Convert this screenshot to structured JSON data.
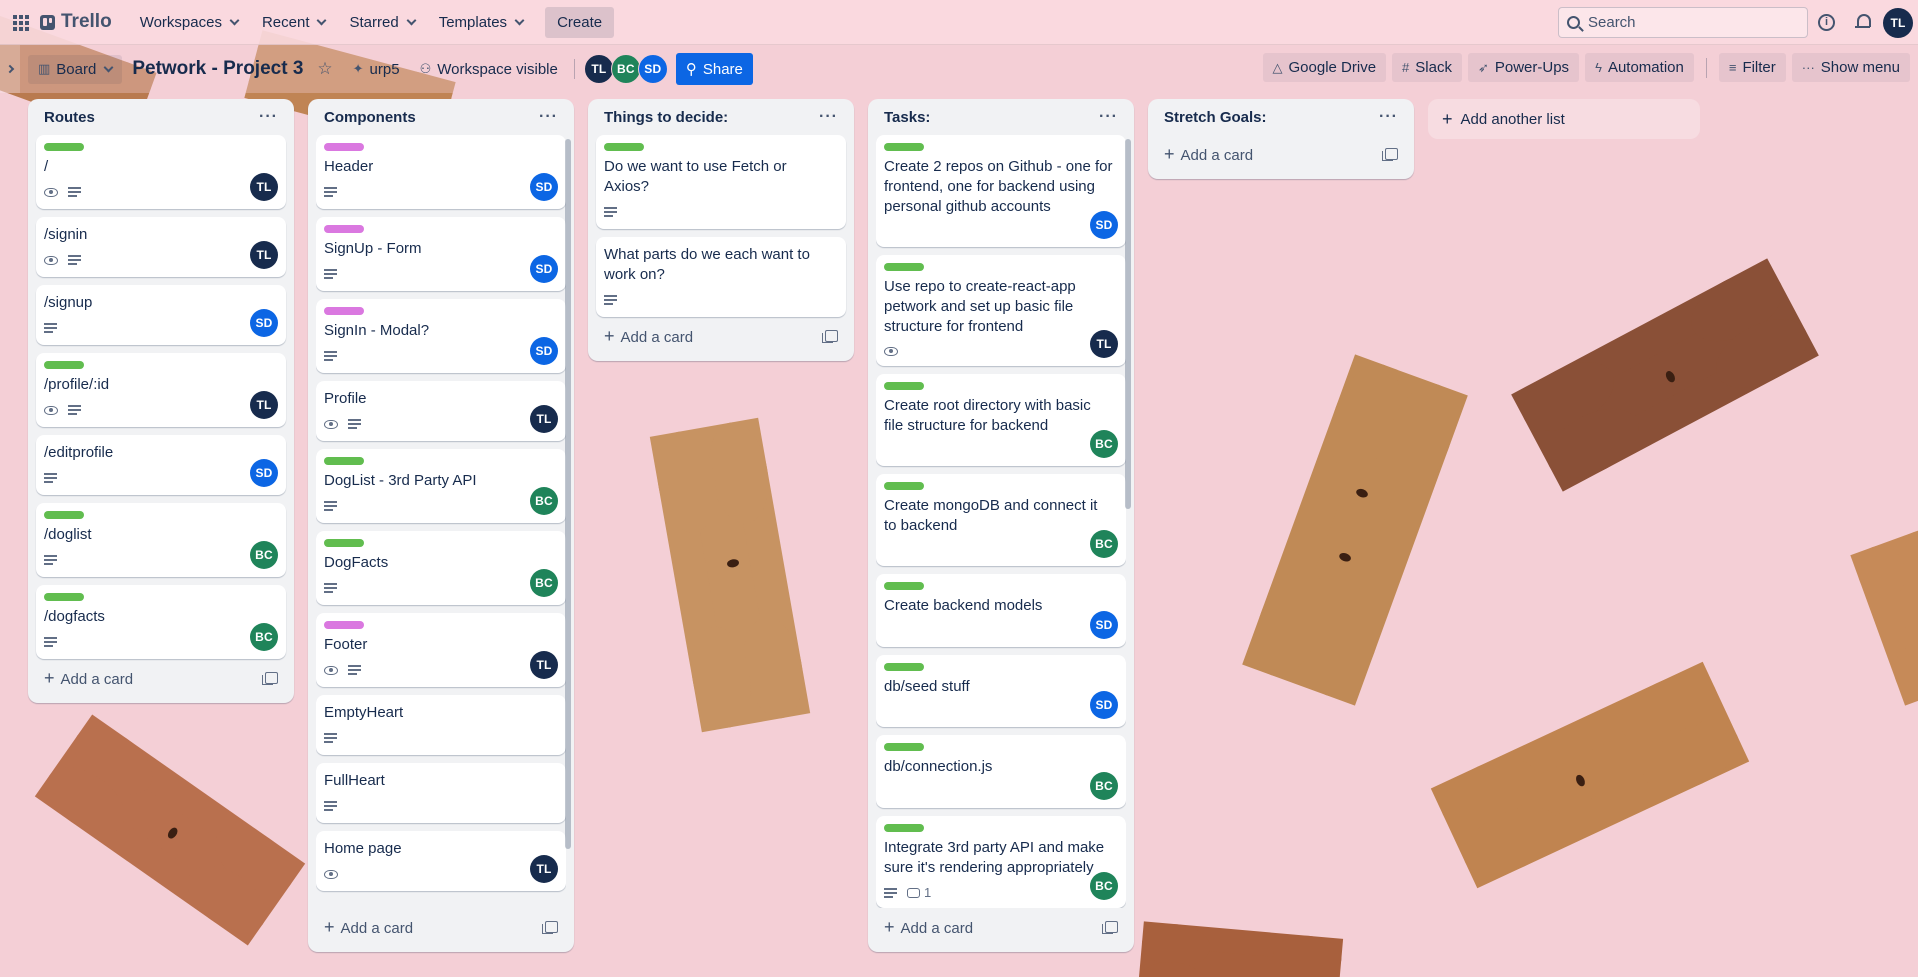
{
  "topnav": {
    "logo": "Trello",
    "menus": [
      "Workspaces",
      "Recent",
      "Starred",
      "Templates"
    ],
    "create_label": "Create",
    "search_placeholder": "Search",
    "user_initials": "TL"
  },
  "board": {
    "view_label": "Board",
    "title": "Petwork - Project 3",
    "workspace_label": "urp5",
    "visibility_label": "Workspace visible",
    "members": [
      "TL",
      "BC",
      "SD"
    ],
    "share_label": "Share",
    "right_buttons": [
      "Google Drive",
      "Slack",
      "Power-Ups",
      "Automation"
    ],
    "filter_label": "Filter",
    "show_menu_label": "Show menu"
  },
  "lists": [
    {
      "title": "Routes",
      "add_label": "Add a card",
      "cards": [
        {
          "title": "/",
          "label": "green",
          "watch": true,
          "desc": true,
          "member": "TL"
        },
        {
          "title": "/signin",
          "label": "",
          "watch": true,
          "desc": true,
          "member": "TL"
        },
        {
          "title": "/signup",
          "label": "",
          "watch": false,
          "desc": true,
          "member": "SD"
        },
        {
          "title": "/profile/:id",
          "label": "green",
          "watch": true,
          "desc": true,
          "member": "TL"
        },
        {
          "title": "/editprofile",
          "label": "",
          "watch": false,
          "desc": true,
          "member": "SD"
        },
        {
          "title": "/doglist",
          "label": "green",
          "watch": false,
          "desc": true,
          "member": "BC"
        },
        {
          "title": "/dogfacts",
          "label": "green",
          "watch": false,
          "desc": true,
          "member": "BC"
        }
      ]
    },
    {
      "title": "Components",
      "add_label": "Add a card",
      "cards": [
        {
          "title": "Header",
          "label": "purple",
          "watch": false,
          "desc": true,
          "member": "SD"
        },
        {
          "title": "SignUp - Form",
          "label": "purple",
          "watch": false,
          "desc": true,
          "member": "SD"
        },
        {
          "title": "SignIn - Modal?",
          "label": "purple",
          "watch": false,
          "desc": true,
          "member": "SD"
        },
        {
          "title": "Profile",
          "label": "",
          "watch": true,
          "desc": true,
          "member": "TL"
        },
        {
          "title": "DogList - 3rd Party API",
          "label": "green",
          "watch": false,
          "desc": true,
          "member": "BC"
        },
        {
          "title": "DogFacts",
          "label": "green",
          "watch": false,
          "desc": true,
          "member": "BC"
        },
        {
          "title": "Footer",
          "label": "purple",
          "watch": true,
          "desc": true,
          "member": "TL"
        },
        {
          "title": "EmptyHeart",
          "label": "",
          "watch": false,
          "desc": true,
          "member": ""
        },
        {
          "title": "FullHeart",
          "label": "",
          "watch": false,
          "desc": true,
          "member": ""
        },
        {
          "title": "Home page",
          "label": "",
          "watch": true,
          "desc": false,
          "member": "TL"
        }
      ]
    },
    {
      "title": "Things to decide:",
      "add_label": "Add a card",
      "cards": [
        {
          "title": "Do we want to use Fetch or Axios?",
          "label": "green",
          "watch": false,
          "desc": true,
          "member": ""
        },
        {
          "title": "What parts do we each want to work on?",
          "label": "",
          "watch": false,
          "desc": true,
          "member": ""
        }
      ]
    },
    {
      "title": "Tasks:",
      "add_label": "Add a card",
      "cards": [
        {
          "title": "Create 2 repos on Github - one for frontend, one for backend using personal github accounts",
          "label": "green",
          "watch": false,
          "desc": false,
          "member": "SD"
        },
        {
          "title": "Use repo to create-react-app petwork and set up basic file structure for frontend",
          "label": "green",
          "watch": true,
          "desc": false,
          "member": "TL"
        },
        {
          "title": "Create root directory with basic file structure for backend",
          "label": "green",
          "watch": false,
          "desc": false,
          "member": "BC"
        },
        {
          "title": "Create mongoDB and connect it to backend",
          "label": "green",
          "watch": false,
          "desc": false,
          "member": "BC"
        },
        {
          "title": "Create backend models",
          "label": "",
          "watch": false,
          "desc": false,
          "member": "SD"
        },
        {
          "title": "db/seed stuff",
          "label": "green",
          "watch": false,
          "desc": false,
          "member": "SD"
        },
        {
          "title": "db/connection.js",
          "label": "green",
          "watch": false,
          "desc": false,
          "member": "BC"
        },
        {
          "title": "Integrate 3rd party API and make sure it's rendering appropriately",
          "label": "green",
          "watch": false,
          "desc": true,
          "comments": "1",
          "member": "BC"
        }
      ]
    },
    {
      "title": "Stretch Goals:",
      "add_label": "Add a card",
      "cards": []
    }
  ],
  "add_list_label": "Add another list",
  "colors": {
    "green_label": "#61bd4f",
    "purple_label": "#da78e0",
    "share": "#0c66e4",
    "tl": "#172b4d",
    "sd": "#0c66e4",
    "bc": "#1f845a"
  }
}
